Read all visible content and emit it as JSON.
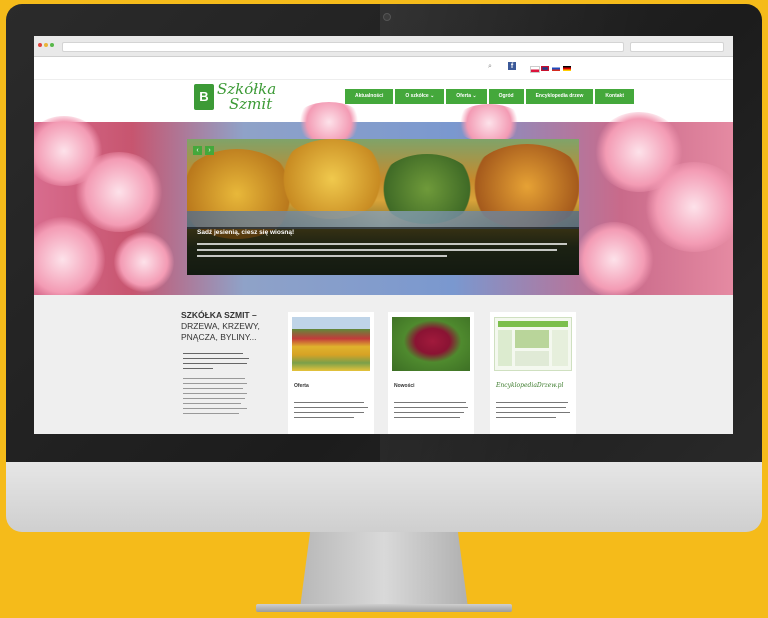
{
  "site": {
    "logo": {
      "line1": "Szkółka",
      "line2": "Szmit",
      "mark_letter": "B"
    },
    "menu": [
      "Aktualności",
      "O szkółce ⌄",
      "Oferta ⌄",
      "Ogród",
      "Encyklopedia drzew",
      "Kontakt"
    ],
    "hero": {
      "caption_title": "Sadź jesienią, ciesz się wiosną!",
      "prev_label": "‹",
      "next_label": "›"
    },
    "intro": {
      "title_line1": "SZKÓŁKA SZMIT –",
      "title_line2": "DRZEWA, KRZEWY,",
      "title_line3": "PNĄCZA, BYLINY..."
    },
    "cards": [
      {
        "title": "Oferta"
      },
      {
        "title": "Nowości"
      },
      {
        "title": "EncyklopediaDrzew.pl"
      }
    ]
  },
  "colors": {
    "accent": "#44a83b",
    "background": "#f5bb1a"
  },
  "icons": [
    "search-icon",
    "facebook-icon",
    "flag-pl-icon",
    "flag-uk-icon",
    "flag-ru-icon",
    "flag-de-icon",
    "chevron-left-icon",
    "chevron-right-icon"
  ]
}
